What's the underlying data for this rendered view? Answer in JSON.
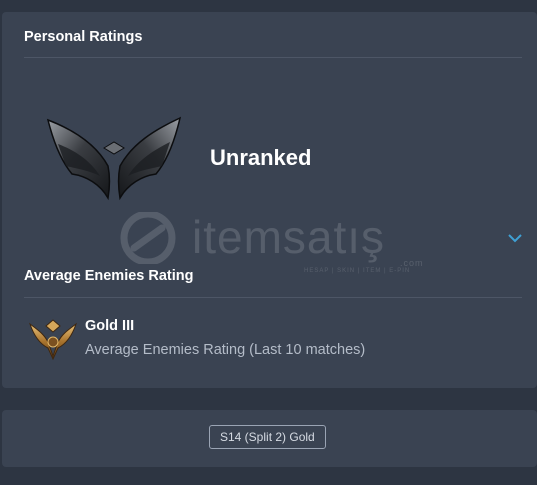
{
  "personal": {
    "title": "Personal Ratings",
    "rank": "Unranked"
  },
  "average": {
    "title": "Average Enemies Rating",
    "tier": "Gold III",
    "subtitle": "Average Enemies Rating (Last 10 matches)"
  },
  "watermark": {
    "text": "itemsatış",
    "tagline": "HESAP | SKIN | ITEM | E-PIN",
    "domain": ".com"
  },
  "footer": {
    "season_badge": "S14 (Split 2) Gold"
  },
  "icons": {
    "unranked": "unranked-emblem-icon",
    "gold": "gold-emblem-icon",
    "expand": "chevron-down-icon"
  },
  "colors": {
    "accent": "#3fa0d4",
    "card": "#3a4352",
    "background": "#2d3542"
  }
}
